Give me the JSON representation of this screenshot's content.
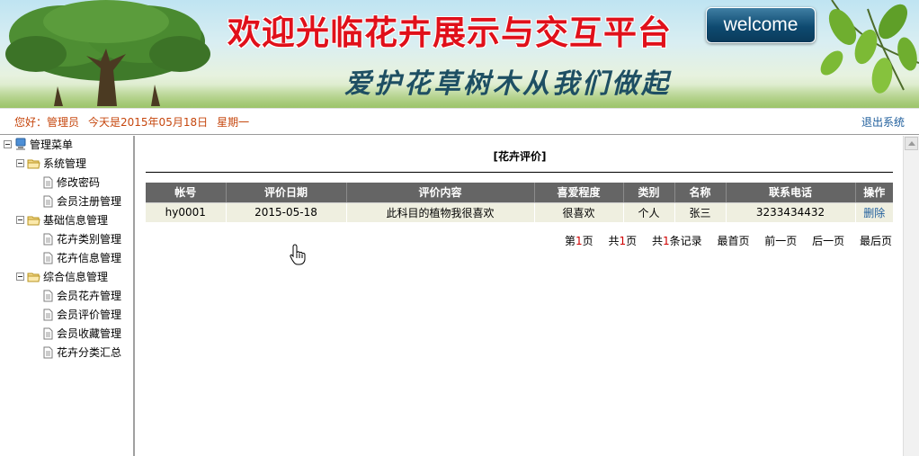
{
  "banner": {
    "title": "欢迎光临花卉展示与交互平台",
    "slogan": "爱护花草树木从我们做起",
    "welcome_button": "welcome"
  },
  "status_bar": {
    "greeting": "您好：管理员",
    "date_text": "今天是2015年05月18日",
    "weekday": "星期一",
    "logout": "退出系统"
  },
  "sidebar": {
    "root": "管理菜单",
    "groups": [
      {
        "label": "系统管理",
        "items": [
          "修改密码",
          "会员注册管理"
        ]
      },
      {
        "label": "基础信息管理",
        "items": [
          "花卉类别管理",
          "花卉信息管理"
        ]
      },
      {
        "label": "综合信息管理",
        "items": [
          "会员花卉管理",
          "会员评价管理",
          "会员收藏管理",
          "花卉分类汇总"
        ]
      }
    ]
  },
  "main": {
    "title": "[花卉评价]",
    "table": {
      "headers": [
        "帐号",
        "评价日期",
        "评价内容",
        "喜爱程度",
        "类别",
        "名称",
        "联系电话",
        "操作"
      ],
      "rows": [
        {
          "account": "hy0001",
          "date": "2015-05-18",
          "content": "此科目的植物我很喜欢",
          "liking": "很喜欢",
          "category": "个人",
          "name": "张三",
          "phone": "3233434432",
          "action": "删除"
        }
      ]
    },
    "pager": {
      "page_prefix": "第",
      "page_num": "1",
      "page_suffix": "页",
      "total_prefix": "共",
      "total_num": "1",
      "total_suffix": "页",
      "records_prefix": "共",
      "records_num": "1",
      "records_suffix": "条记录",
      "first": "最首页",
      "prev": "前一页",
      "next": "后一页",
      "last": "最后页"
    }
  },
  "colors": {
    "title_red": "#e0101a",
    "greeting_orange": "#c6470e",
    "link_blue": "#1f5e9c",
    "table_header": "#656565",
    "table_row": "#efefe0"
  }
}
